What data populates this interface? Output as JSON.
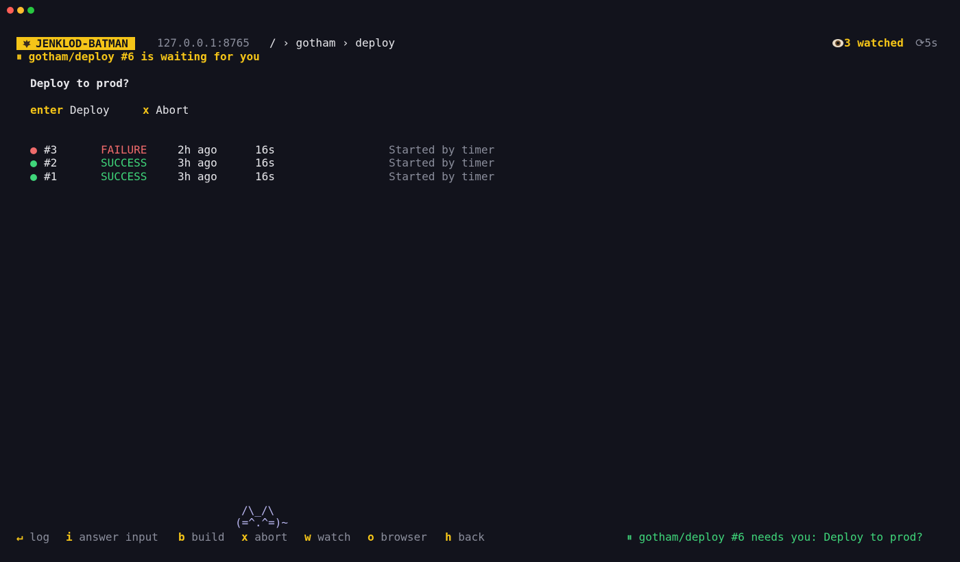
{
  "window": {
    "controls": [
      "close",
      "minimize",
      "maximize"
    ]
  },
  "header": {
    "brand_icon": "bat-icon",
    "brand": "JENKLOD-BATMAN",
    "host": "127.0.0.1:8765",
    "breadcrumb": "/ › gotham › deploy",
    "watch_icon": "eye-icon",
    "watched": "3 watched",
    "refresh_icon": "refresh-icon",
    "refresh_interval": "5s"
  },
  "banner": {
    "icon": "pause-icon",
    "text": "gotham/deploy #6 is waiting for you"
  },
  "prompt": {
    "question": "Deploy to prod?",
    "actions": [
      {
        "key": "enter",
        "label": "Deploy"
      },
      {
        "key": "x",
        "label": "Abort"
      }
    ]
  },
  "builds": [
    {
      "number": "#3",
      "status": "FAILURE",
      "when": "2h ago",
      "duration": "16s",
      "cause": "Started by timer"
    },
    {
      "number": "#2",
      "status": "SUCCESS",
      "when": "3h ago",
      "duration": "16s",
      "cause": "Started by timer"
    },
    {
      "number": "#1",
      "status": "SUCCESS",
      "when": "3h ago",
      "duration": "16s",
      "cause": "Started by timer"
    }
  ],
  "mascot": {
    "line1": "/\\_/\\",
    "line2": "(=^.^=)~"
  },
  "footer": {
    "keys": [
      {
        "key": "↵",
        "label": "log"
      },
      {
        "key": "i",
        "label": "answer input"
      },
      {
        "key": "b",
        "label": "build"
      },
      {
        "key": "x",
        "label": "abort"
      },
      {
        "key": "w",
        "label": "watch"
      },
      {
        "key": "o",
        "label": "browser"
      },
      {
        "key": "h",
        "label": "back"
      }
    ],
    "notification_icon": "pause-icon",
    "notification": "gotham/deploy #6 needs you: Deploy to prod?"
  },
  "colors": {
    "background": "#12131c",
    "accent": "#f5c518",
    "failure": "#ef6b6b",
    "success": "#3fd67a",
    "muted": "#8b8e9c"
  }
}
